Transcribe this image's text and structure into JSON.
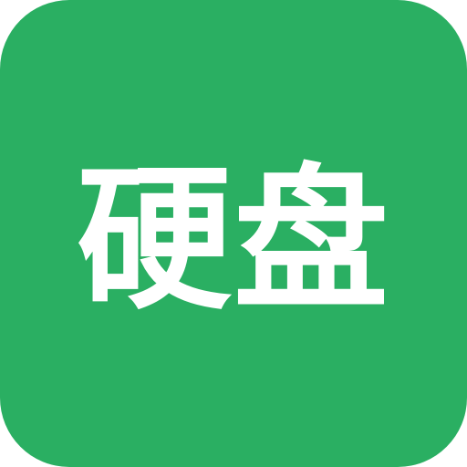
{
  "icon": {
    "label": "硬盘",
    "background_color": "#2aaf62",
    "text_color": "#ffffff"
  }
}
